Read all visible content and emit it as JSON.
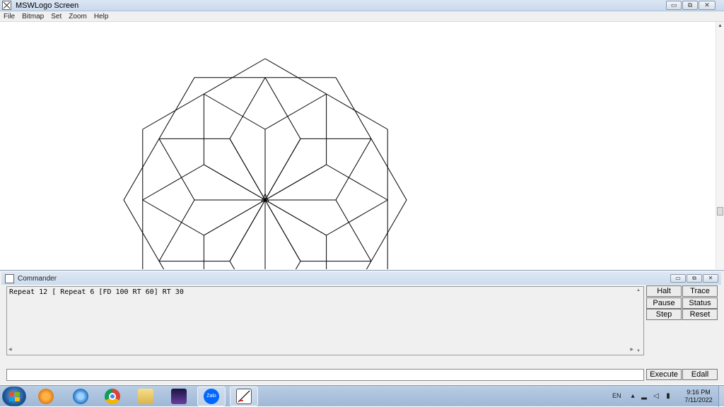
{
  "window": {
    "title": "MSWLogo Screen",
    "menu": [
      "File",
      "Bitmap",
      "Set",
      "Zoom",
      "Help"
    ],
    "controls": {
      "minimize": "▭",
      "restore": "⧉",
      "close": "✕"
    }
  },
  "drawing": {
    "command_shape": "12 hexagons of side 100 rotated 30° apart",
    "line_color": "#000000"
  },
  "commander": {
    "title": "Commander",
    "history_text": "Repeat 12 [ Repeat 6 [FD 100 RT 60] RT 30",
    "input_value": "",
    "buttons": {
      "halt": "Halt",
      "trace": "Trace",
      "pause": "Pause",
      "status": "Status",
      "step": "Step",
      "reset": "Reset",
      "execute": "Execute",
      "edall": "Edall"
    }
  },
  "taskbar": {
    "apps": [
      "windows-media-player-icon",
      "internet-explorer-icon",
      "chrome-icon",
      "file-explorer-icon",
      "night-sky-app-icon",
      "zalo-icon",
      "mswlogo-icon"
    ],
    "zalo_label": "Zalo",
    "language": "EN",
    "time": "9:16 PM",
    "date": "7/11/2022"
  }
}
